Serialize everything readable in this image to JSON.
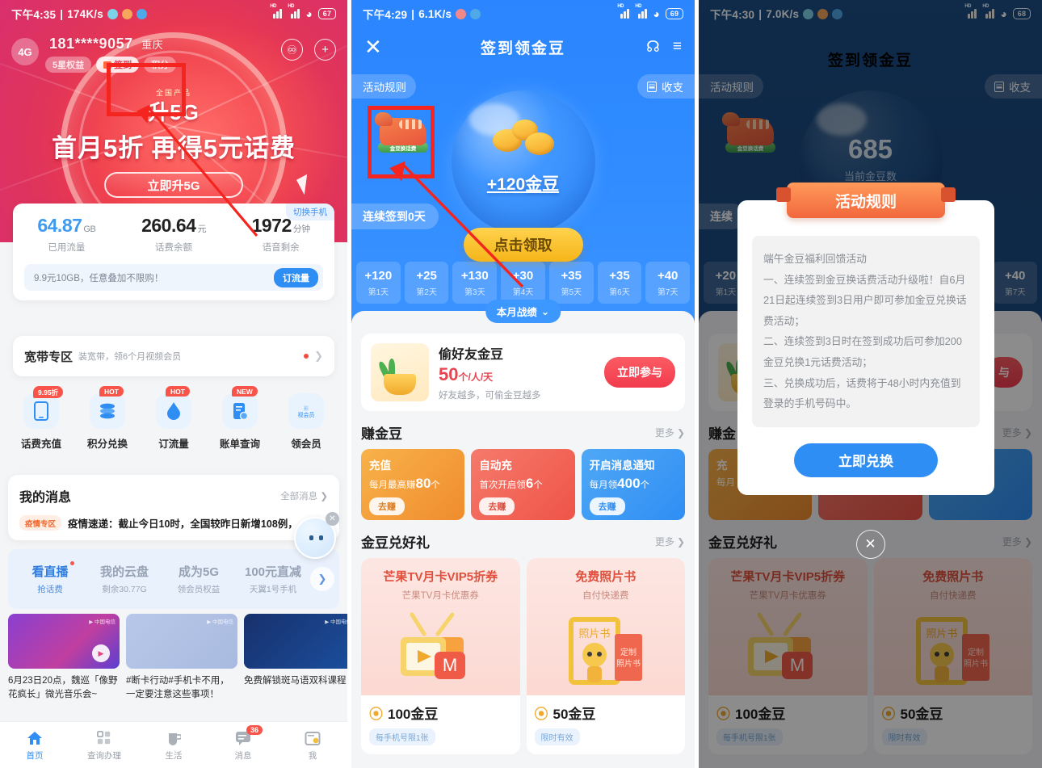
{
  "panel1": {
    "status": {
      "time": "下午4:35",
      "speed": "174K/s",
      "battery": "67",
      "net": "HD"
    },
    "account": {
      "sim": "4G",
      "number": "181****9057",
      "region": "重庆",
      "tag_benefit": "5星权益",
      "tag_signin": "签到",
      "tag_points": "积分"
    },
    "hero": {
      "small": "全国产品",
      "line1": "升5G",
      "line2": "首月5折 再得5元话费",
      "button": "立即升5G"
    },
    "stats": {
      "switch": "切换手机",
      "items": [
        {
          "value": "64.87",
          "unit": "GB",
          "label": "已用流量"
        },
        {
          "value": "260.64",
          "unit": "元",
          "label": "话费余额"
        },
        {
          "value": "1972",
          "unit": "分钟",
          "label": "语音剩余"
        }
      ],
      "promo_text": "9.9元10GB，任意叠加不限购！",
      "promo_button": "订流量"
    },
    "broadband": {
      "title": "宽带专区",
      "sub": "装宽带，领6个月视频会员"
    },
    "quick": [
      {
        "label": "话费充值",
        "badge": "9.95折",
        "icon": "phone-icon"
      },
      {
        "label": "积分兑换",
        "badge": "HOT",
        "icon": "coins-icon"
      },
      {
        "label": "订流量",
        "badge": "HOT",
        "icon": "droplet-icon"
      },
      {
        "label": "账单查询",
        "badge": "NEW",
        "icon": "bill-icon"
      },
      {
        "label": "领会员",
        "badge": "",
        "icon": "vip-icon"
      }
    ],
    "messages": {
      "title": "我的消息",
      "more": "全部消息",
      "tag": "疫情专区",
      "text": "疫情速递：截止今日10时，全国较昨日新增108例，"
    },
    "tabs": [
      {
        "a": "看直播",
        "b": "抢话费",
        "dot": true
      },
      {
        "a": "我的云盘",
        "b": "剩余30.77G",
        "dot": false
      },
      {
        "a": "成为5G",
        "b": "领会员权益",
        "dot": false
      },
      {
        "a": "100元直减",
        "b": "天翼1号手机",
        "dot": false
      }
    ],
    "feed": [
      {
        "caption": "6月23日20点，魏巡「像野花疯长」微光音乐会~"
      },
      {
        "caption": "#断卡行动#手机卡不用，一定要注意这些事项！"
      },
      {
        "caption": "免费解锁斑马语双科课程"
      }
    ],
    "nav": [
      {
        "label": "首页",
        "icon": "home-icon",
        "badge": ""
      },
      {
        "label": "查询办理",
        "icon": "grid-icon",
        "badge": ""
      },
      {
        "label": "生活",
        "icon": "cup-icon",
        "badge": ""
      },
      {
        "label": "消息",
        "icon": "message-icon",
        "badge": "36"
      },
      {
        "label": "我",
        "icon": "user-icon",
        "badge": ""
      }
    ]
  },
  "panel2": {
    "status": {
      "time": "下午4:29",
      "speed": "6.1K/s",
      "battery": "69",
      "net": "HD"
    },
    "nav": {
      "title": "签到领金豆",
      "close": "✕",
      "service": "headset-icon",
      "menu": "menu-icon"
    },
    "pill_left": "活动规则",
    "pill_right": "收支",
    "dino_label": "金豆换话费",
    "orb_text": "+120金豆",
    "claim_button": "点击领取",
    "streak": "连续签到0天",
    "days": [
      {
        "amount": "+120",
        "day": "第1天"
      },
      {
        "amount": "+25",
        "day": "第2天"
      },
      {
        "amount": "+130",
        "day": "第3天"
      },
      {
        "amount": "+30",
        "day": "第4天"
      },
      {
        "amount": "+35",
        "day": "第5天"
      },
      {
        "amount": "+35",
        "day": "第6天"
      },
      {
        "amount": "+40",
        "day": "第7天"
      }
    ],
    "month_button": "本月战绩",
    "steal": {
      "title": "偷好友金豆",
      "num": "50",
      "unit": "个/人/天",
      "sub": "好友越多，可偷金豆越多",
      "button": "立即参与"
    },
    "earn_section": {
      "title": "赚金豆",
      "more": "更多"
    },
    "earn": [
      {
        "t1": "充值",
        "t2a": "每月最高赚",
        "t2b": "80",
        "t2c": "个",
        "go": "去赚",
        "color": "#f5a623"
      },
      {
        "t1": "自动充",
        "t2a": "首次开启领",
        "t2b": "6",
        "t2c": "个",
        "go": "去赚",
        "color": "#f0614f"
      },
      {
        "t1": "开启消息通知",
        "t2a": "每月领",
        "t2b": "400",
        "t2c": "个",
        "go": "去赚",
        "color": "#3d9bf0"
      }
    ],
    "gift_section": {
      "title": "金豆兑好礼",
      "more": "更多"
    },
    "gifts": [
      {
        "title": "芒果TV月卡VIP5折券",
        "sub": "芒果TV月卡优惠券",
        "price": "100金豆",
        "limit": "每手机号限1张"
      },
      {
        "title": "免费照片书",
        "sub": "自付快递费",
        "price": "50金豆",
        "limit": "限时有效"
      }
    ]
  },
  "panel3": {
    "status": {
      "time": "下午4:30",
      "speed": "7.0K/s",
      "battery": "68",
      "net": "HD"
    },
    "nav": {
      "title": "签到领金豆",
      "close": "✕"
    },
    "pill_left": "活动规则",
    "pill_right": "收支",
    "dino_label": "金豆换话费",
    "orb_num": "685",
    "orb_sub": "当前金豆数",
    "streak": "连续",
    "days": [
      {
        "amount": "+20",
        "day": "第1天"
      },
      {
        "amount": "+40",
        "day": "第7天"
      }
    ],
    "modal": {
      "ribbon": "活动规则",
      "paragraphs": [
        "端午金豆福利回馈活动",
        "一、连续签到金豆换话费活动升级啦！自6月21日起连续签到3日用户即可参加金豆兑换话费活动；",
        "二、连续签到3日时在签到成功后可参加200金豆兑换1元话费活动；",
        "三、兑换成功后，话费将于48小时内充值到登录的手机号码中。"
      ],
      "button": "立即兑换",
      "close": "✕"
    },
    "earn_section_title": "赚金",
    "gift_section": {
      "title": "金豆兑好礼",
      "more": "更多"
    },
    "gifts": [
      {
        "title": "芒果TV月卡VIP5折券",
        "sub": "芒果TV月卡优惠券",
        "price": "100金豆",
        "limit": "每手机号限1张"
      },
      {
        "title": "免费照片书",
        "sub": "自付快递费",
        "price": "50金豆",
        "limit": "限时有效"
      }
    ]
  },
  "annotations": {
    "color": "#f4241e",
    "box1_name": "signin-button-highlight",
    "box2_name": "exchange-entry-highlight"
  }
}
